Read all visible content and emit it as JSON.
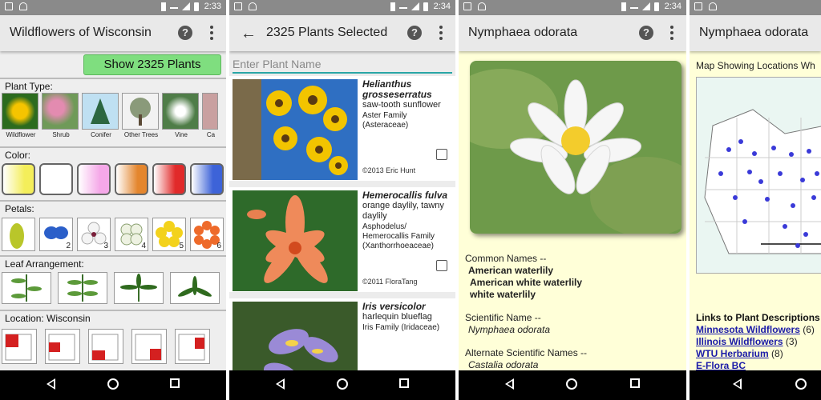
{
  "status": {
    "time1": "2:33",
    "time2": "2:34",
    "time3": "2:34",
    "time4": "2:34"
  },
  "screen1": {
    "title": "Wildflowers of Wisconsin",
    "show_button": "Show 2325 Plants",
    "plant_type_label": "Plant Type:",
    "plant_types": [
      "Wildflower",
      "Shrub",
      "Conifer",
      "Other Trees",
      "Vine",
      "Ca"
    ],
    "color_label": "Color:",
    "colors": [
      "#f4ee5a",
      "#ffffff",
      "#f5a8e8",
      "#e4862e",
      "#e12a2a",
      "#3d63d8"
    ],
    "petals_label": "Petals:",
    "petal_numbers": [
      "",
      "2",
      "3",
      "4",
      "5",
      "6"
    ],
    "leaf_label": "Leaf Arrangement:",
    "location_label": "Location: Wisconsin"
  },
  "screen2": {
    "title": "2325 Plants Selected",
    "search_placeholder": "Enter Plant Name",
    "plants": [
      {
        "sci": "Helianthus grosseserratus",
        "common": "saw-tooth sunflower",
        "family": "Aster Family (Asteraceae)",
        "credit": "©2013 Eric Hunt"
      },
      {
        "sci": "Hemerocallis fulva",
        "common": "orange daylily, tawny daylily",
        "family": "Asphodelus/ Hemerocallis Family (Xanthorrhoeaceae)",
        "credit": "©2011 FloraTang"
      },
      {
        "sci": "Iris versicolor",
        "common": "harlequin blueflag",
        "family": "Iris Family (Iridaceae)",
        "credit": ""
      }
    ]
  },
  "screen3": {
    "title": "Nymphaea odorata",
    "common_h": "Common Names --",
    "common_names": [
      "American waterlily",
      "American white waterlily",
      "white waterlily"
    ],
    "scientific_h": "Scientific Name --",
    "scientific": "Nymphaea odorata",
    "alt_h": "Alternate Scientific Names --",
    "alt": "Castalia odorata"
  },
  "screen4": {
    "title": "Nymphaea odorata",
    "map_caption": "Map Showing Locations Wh",
    "links_h": "Links to Plant Descriptions",
    "links": [
      {
        "label": "Minnesota Wildflowers",
        "count": "(6)"
      },
      {
        "label": "Illinois Wildflowers",
        "count": "(3)"
      },
      {
        "label": "WTU Herbarium",
        "count": "(8)"
      },
      {
        "label": "E-Flora BC",
        "count": ""
      }
    ]
  }
}
